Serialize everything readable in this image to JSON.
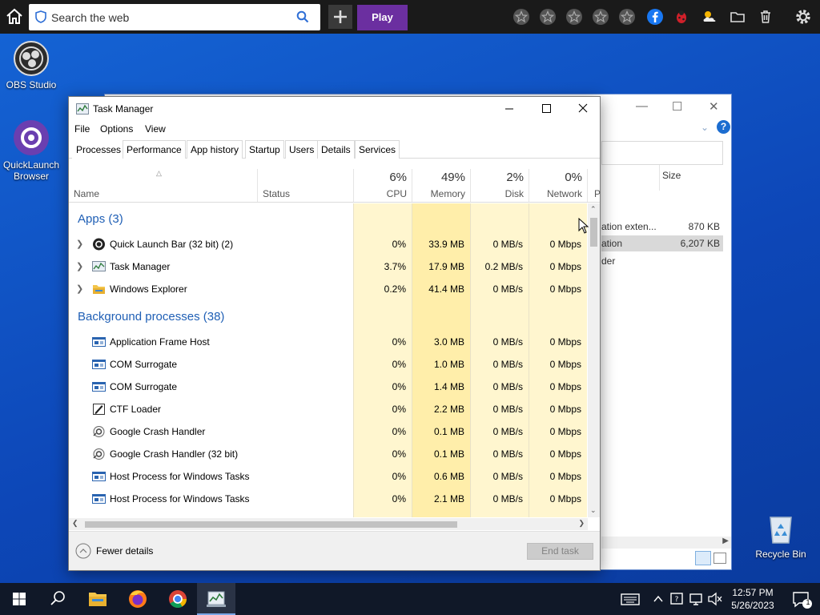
{
  "topbar": {
    "search_placeholder": "Search the web",
    "play_label": "Play",
    "icons": [
      "home-icon",
      "shield-icon",
      "search-icon",
      "plus-icon",
      "star-icon",
      "star-icon",
      "star-icon",
      "star-icon",
      "star-icon",
      "facebook-icon",
      "ladybug-icon",
      "weather-icon",
      "folder-icon",
      "trash-icon",
      "gear-icon"
    ]
  },
  "desktop": {
    "icons": [
      {
        "label": "OBS Studio",
        "icon": "obs-icon"
      },
      {
        "label": "QuickLaunch Browser",
        "icon": "quicklaunch-icon"
      },
      {
        "label": "Recycle Bin",
        "icon": "recycle-bin-icon"
      }
    ]
  },
  "explorer": {
    "size_header": "Size",
    "rows": [
      {
        "name": "ation exten...",
        "size": "870 KB",
        "selected": false
      },
      {
        "name": "ation",
        "size": "6,207 KB",
        "selected": true
      },
      {
        "name": "der",
        "size": "",
        "selected": false
      }
    ]
  },
  "taskmanager": {
    "title": "Task Manager",
    "menu": [
      "File",
      "Options",
      "View"
    ],
    "tabs": [
      "Processes",
      "Performance",
      "App history",
      "Startup",
      "Users",
      "Details",
      "Services"
    ],
    "active_tab": "Processes",
    "columns": {
      "name": "Name",
      "status": "Status",
      "cpu": {
        "pct": "6%",
        "label": "CPU"
      },
      "memory": {
        "pct": "49%",
        "label": "Memory"
      },
      "disk": {
        "pct": "2%",
        "label": "Disk"
      },
      "network": {
        "pct": "0%",
        "label": "Network"
      },
      "power_truncated": "P"
    },
    "groups": {
      "apps": "Apps (3)",
      "background": "Background processes (38)"
    },
    "apps": [
      {
        "name": "Quick Launch Bar (32 bit) (2)",
        "icon": "quicklaunch-icon",
        "cpu": "0%",
        "memory": "33.9 MB",
        "disk": "0 MB/s",
        "network": "0 Mbps"
      },
      {
        "name": "Task Manager",
        "icon": "taskmanager-icon",
        "cpu": "3.7%",
        "memory": "17.9 MB",
        "disk": "0.2 MB/s",
        "network": "0 Mbps"
      },
      {
        "name": "Windows Explorer",
        "icon": "folder-icon",
        "cpu": "0.2%",
        "memory": "41.4 MB",
        "disk": "0 MB/s",
        "network": "0 Mbps"
      }
    ],
    "background": [
      {
        "name": "Application Frame Host",
        "icon": "process-icon",
        "cpu": "0%",
        "memory": "3.0 MB",
        "disk": "0 MB/s",
        "network": "0 Mbps"
      },
      {
        "name": "COM Surrogate",
        "icon": "process-icon",
        "cpu": "0%",
        "memory": "1.0 MB",
        "disk": "0 MB/s",
        "network": "0 Mbps"
      },
      {
        "name": "COM Surrogate",
        "icon": "process-icon",
        "cpu": "0%",
        "memory": "1.4 MB",
        "disk": "0 MB/s",
        "network": "0 Mbps"
      },
      {
        "name": "CTF Loader",
        "icon": "ctf-icon",
        "cpu": "0%",
        "memory": "2.2 MB",
        "disk": "0 MB/s",
        "network": "0 Mbps"
      },
      {
        "name": "Google Crash Handler",
        "icon": "crash-handler-icon",
        "cpu": "0%",
        "memory": "0.1 MB",
        "disk": "0 MB/s",
        "network": "0 Mbps"
      },
      {
        "name": "Google Crash Handler (32 bit)",
        "icon": "crash-handler-icon",
        "cpu": "0%",
        "memory": "0.1 MB",
        "disk": "0 MB/s",
        "network": "0 Mbps"
      },
      {
        "name": "Host Process for Windows Tasks",
        "icon": "process-icon",
        "cpu": "0%",
        "memory": "0.6 MB",
        "disk": "0 MB/s",
        "network": "0 Mbps"
      },
      {
        "name": "Host Process for Windows Tasks",
        "icon": "process-icon",
        "cpu": "0%",
        "memory": "2.1 MB",
        "disk": "0 MB/s",
        "network": "0 Mbps"
      }
    ],
    "fewer_details": "Fewer details",
    "end_task": "End task"
  },
  "taskbar": {
    "time": "12:57 PM",
    "date": "5/26/2023",
    "notification_count": "1",
    "pinned": [
      "windows-start-icon",
      "search-icon",
      "file-explorer-icon",
      "firefox-icon",
      "chrome-icon",
      "taskmanager-icon"
    ]
  },
  "colors": {
    "desktop_blue": "#0d47b8",
    "heat_light": "#fff9d6",
    "heat_mid": "#fff2b8",
    "heat_strong": "#ffe99a",
    "group_blue": "#1f5fb5",
    "play_purple": "#6b2fa0"
  }
}
